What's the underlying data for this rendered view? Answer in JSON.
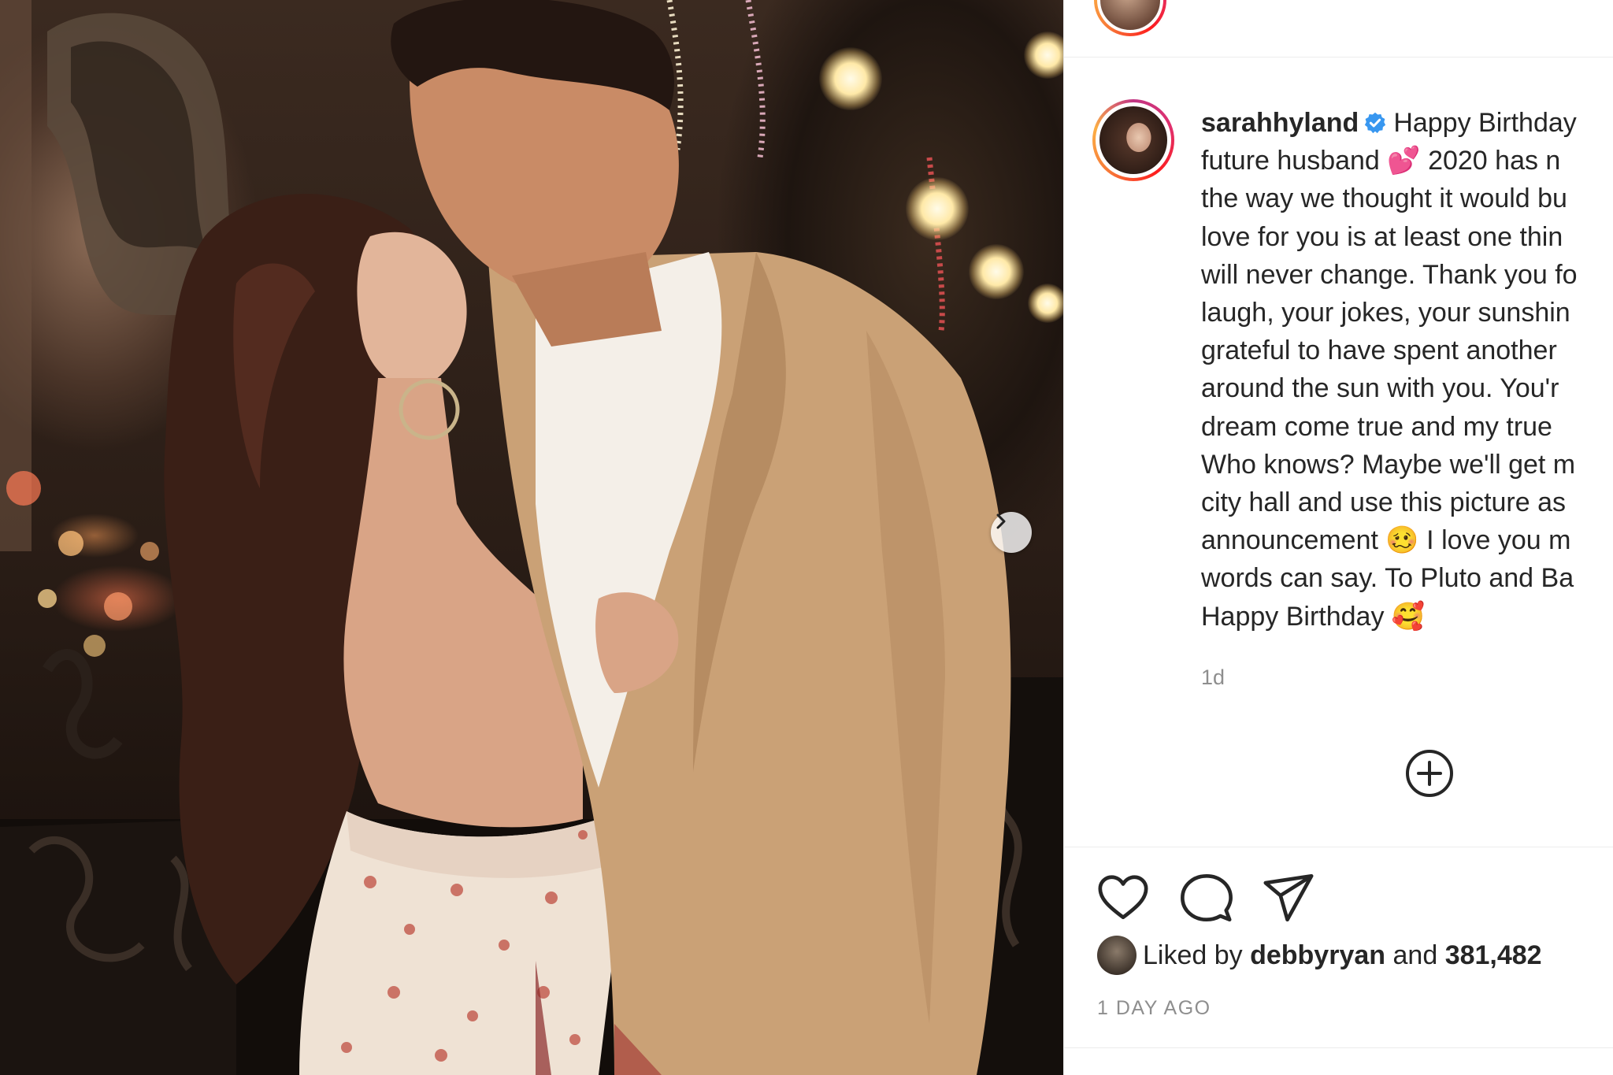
{
  "post": {
    "username": "sarahhyland",
    "caption_lines": [
      "Happy Birthday",
      "future husband 💕  2020 has n",
      "the way we thought it would bu",
      "love for you is at least one thin",
      "will never change. Thank you fo",
      "laugh, your jokes, your sunshin",
      "grateful to have spent another",
      "around the sun with you. You'r",
      "dream come true and my true",
      "Who knows? Maybe we'll get m",
      "city hall and use this picture as",
      "announcement 🥴  I love you m",
      "words can say. To Pluto and Ba",
      "Happy Birthday 🥰"
    ],
    "time_ago": "1d",
    "likes": {
      "prefix": "Liked by",
      "liker": "debbyryan",
      "joiner": "and",
      "count": "381,482"
    },
    "posted": "1 DAY AGO"
  },
  "icons": {
    "verified": "verified-badge-icon",
    "next": "chevron-right-icon",
    "add_comment": "plus-circle-icon",
    "like": "heart-icon",
    "comment": "comment-bubble-icon",
    "share": "paper-plane-icon"
  },
  "colors": {
    "text": "#262626",
    "muted": "#8e8e8e",
    "verified": "#3897f0",
    "divider": "#ececec"
  }
}
